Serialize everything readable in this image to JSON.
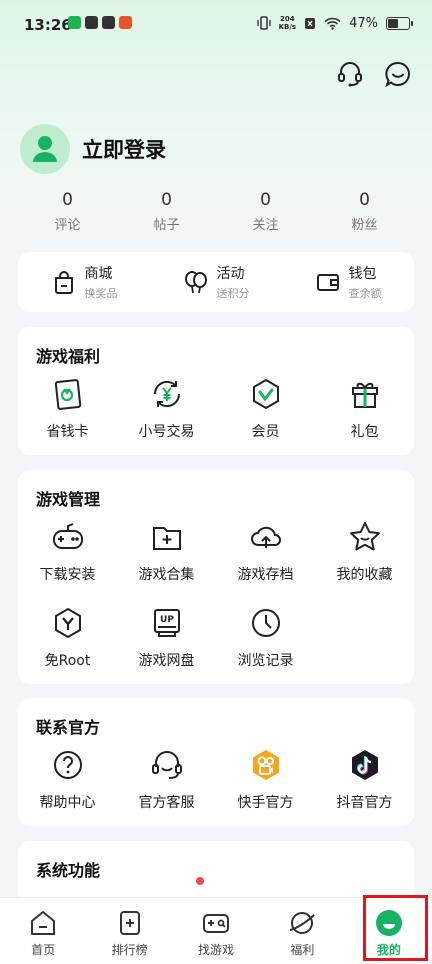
{
  "status_bar": {
    "time": "13:26",
    "net_speed_top": "204",
    "net_speed_bottom": "KB/s",
    "battery": "47%",
    "app_icon_colors": [
      "#1db553",
      "#333333",
      "#333333",
      "#e5552e"
    ]
  },
  "header": {
    "login_label": "立即登录"
  },
  "stats": [
    {
      "value": "0",
      "label": "评论"
    },
    {
      "value": "0",
      "label": "帖子"
    },
    {
      "value": "0",
      "label": "关注"
    },
    {
      "value": "0",
      "label": "粉丝"
    }
  ],
  "quick": [
    {
      "title": "商城",
      "sub": "换奖品",
      "icon": "shop-bag-icon"
    },
    {
      "title": "活动",
      "sub": "送积分",
      "icon": "balloon-icon"
    },
    {
      "title": "钱包",
      "sub": "查余额",
      "icon": "wallet-icon"
    }
  ],
  "welfare": {
    "title": "游戏福利",
    "items": [
      {
        "label": "省钱卡",
        "icon": "save-card-icon"
      },
      {
        "label": "小号交易",
        "icon": "yuan-exchange-icon"
      },
      {
        "label": "会员",
        "icon": "vip-badge-icon"
      },
      {
        "label": "礼包",
        "icon": "gift-icon"
      }
    ]
  },
  "manage": {
    "title": "游戏管理",
    "items": [
      {
        "label": "下载安装",
        "icon": "gamepad-icon"
      },
      {
        "label": "游戏合集",
        "icon": "folder-add-icon"
      },
      {
        "label": "游戏存档",
        "icon": "cloud-upload-icon"
      },
      {
        "label": "我的收藏",
        "icon": "star-icon"
      },
      {
        "label": "免Root",
        "icon": "hexagon-y-icon"
      },
      {
        "label": "游戏网盘",
        "icon": "up-disk-icon"
      },
      {
        "label": "浏览记录",
        "icon": "clock-icon"
      }
    ]
  },
  "contact": {
    "title": "联系官方",
    "items": [
      {
        "label": "帮助中心",
        "icon": "question-icon"
      },
      {
        "label": "官方客服",
        "icon": "headset-icon"
      },
      {
        "label": "快手官方",
        "icon": "kuaishou-icon"
      },
      {
        "label": "抖音官方",
        "icon": "douyin-icon"
      }
    ]
  },
  "system": {
    "title": "系统功能"
  },
  "tabs": [
    {
      "label": "首页",
      "icon": "home-icon"
    },
    {
      "label": "排行榜",
      "icon": "ranking-icon"
    },
    {
      "label": "找游戏",
      "icon": "find-game-icon"
    },
    {
      "label": "福利",
      "icon": "planet-icon"
    },
    {
      "label": "我的",
      "icon": "profile-face-icon",
      "active": true
    }
  ],
  "colors": {
    "accent": "#17b365",
    "highlight_border": "#e0181e",
    "badge_red": "#f24a4a"
  }
}
